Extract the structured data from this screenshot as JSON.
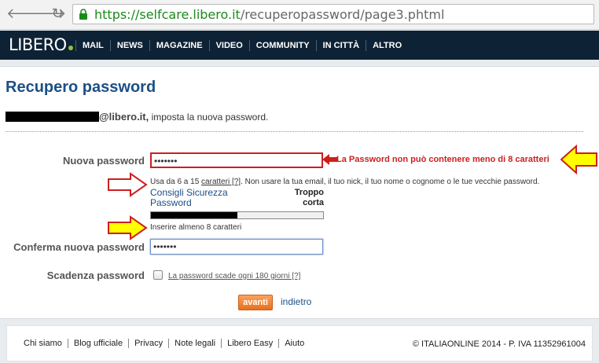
{
  "browser": {
    "url_scheme": "https://",
    "url_host": "selfcare.libero.it",
    "url_path": "/recuperopassword/page3.phtml"
  },
  "header": {
    "logo": "LIBERO",
    "nav": [
      "MAIL",
      "NEWS",
      "MAGAZINE",
      "VIDEO",
      "COMMUNITY",
      "IN CITTÀ",
      "ALTRO"
    ]
  },
  "page": {
    "title": "Recupero password",
    "email_domain": "@libero.it,",
    "email_suffix": " imposta la nuova password."
  },
  "form": {
    "new_password_label": "Nuova password",
    "new_password_value": "•••••••",
    "error_text": "La Password non può contenere meno di 8 caratteri",
    "hint_prefix": "Usa da 6 a 15 ",
    "hint_link": "caratteri",
    "hint_help": " [?]",
    "hint_suffix": ". Non usare la tua email, il tuo nick, il tuo nome o cognome o le tue vecchie password.",
    "security_link": "Consigli Sicurezza Password",
    "strength_text": "Troppo corta",
    "strength_level": 0.5,
    "min_hint": "Inserire almeno 8 caratteri",
    "confirm_label": "Conferma nuova password",
    "confirm_value": "•••••••",
    "expiry_label": "Scadenza password",
    "expiry_checkbox_label": "La password scade ogni 180 giorni [?]",
    "expiry_checked": false,
    "submit_label": "avanti",
    "back_label": "indietro"
  },
  "footer": {
    "links": [
      "Chi siamo",
      "Blog ufficiale",
      "Privacy",
      "Note legali",
      "Libero Easy",
      "Aiuto"
    ],
    "copyright": "© ITALIAONLINE 2014 - P. IVA 11352961004"
  },
  "colors": {
    "nav_bg": "#0e2235",
    "title": "#1c4f86",
    "error": "#cc1f1f",
    "button": "#e8701d",
    "annotation_arrow": "#ffff00"
  }
}
